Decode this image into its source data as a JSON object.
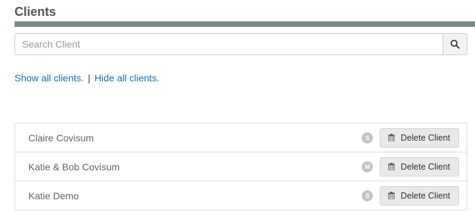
{
  "page": {
    "title": "Clients"
  },
  "search": {
    "placeholder": "Search Client",
    "value": "",
    "icon": "search-icon"
  },
  "links": {
    "show_all": "Show all clients.",
    "separator": "|",
    "hide_all": "Hide all clients."
  },
  "clients": [
    {
      "name": "Claire Covisum",
      "badge": "S",
      "action_label": "Delete Client",
      "action_icon": "trash-icon"
    },
    {
      "name": "Katie & Bob Covisum",
      "badge": "M",
      "action_label": "Delete Client",
      "action_icon": "trash-icon"
    },
    {
      "name": "Katie Demo",
      "badge": "S",
      "action_label": "Delete Client",
      "action_icon": "trash-icon"
    }
  ],
  "colors": {
    "rule": "#7d8b8b",
    "link": "#1a6bbf",
    "badge": "#c3c3c3",
    "button_bg": "#e9e9e9"
  }
}
